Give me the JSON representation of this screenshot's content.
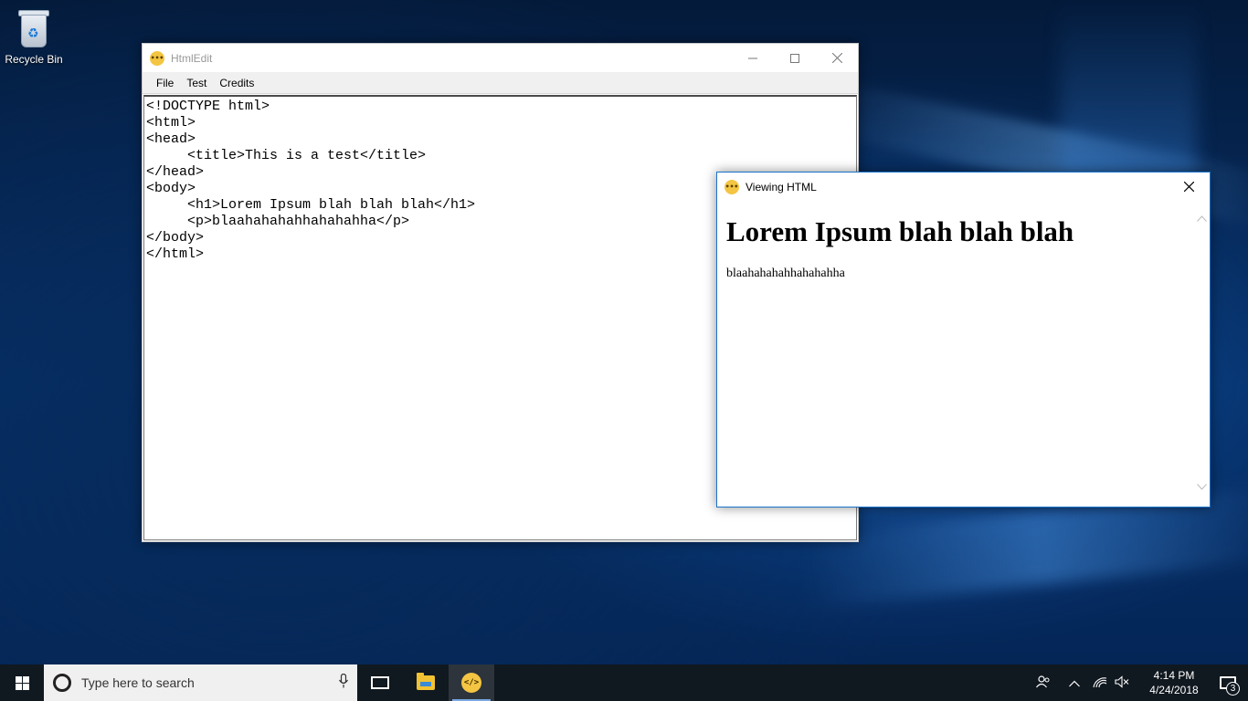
{
  "desktop": {
    "icons": [
      {
        "label": "Recycle Bin",
        "icon": "recycle-bin-icon"
      }
    ]
  },
  "editor_window": {
    "title": "HtmlEdit",
    "menu": [
      "File",
      "Test",
      "Credits"
    ],
    "code": "<!DOCTYPE html>\n<html>\n<head>\n     <title>This is a test</title>\n</head>\n<body>\n     <h1>Lorem Ipsum blah blah blah</h1>\n     <p>blaahahahahhahahahha</p>\n</body>\n</html>"
  },
  "viewer_window": {
    "title": "Viewing HTML",
    "heading": "Lorem Ipsum blah blah blah",
    "paragraph": "blaahahahahhahahahha"
  },
  "taskbar": {
    "search_placeholder": "Type here to search",
    "clock_time": "4:14 PM",
    "clock_date": "4/24/2018",
    "notification_count": "3",
    "app_icon_text": "</>"
  },
  "colors": {
    "accent": "#1a73c9",
    "taskbar": "#101820",
    "app_icon": "#f4c542"
  }
}
